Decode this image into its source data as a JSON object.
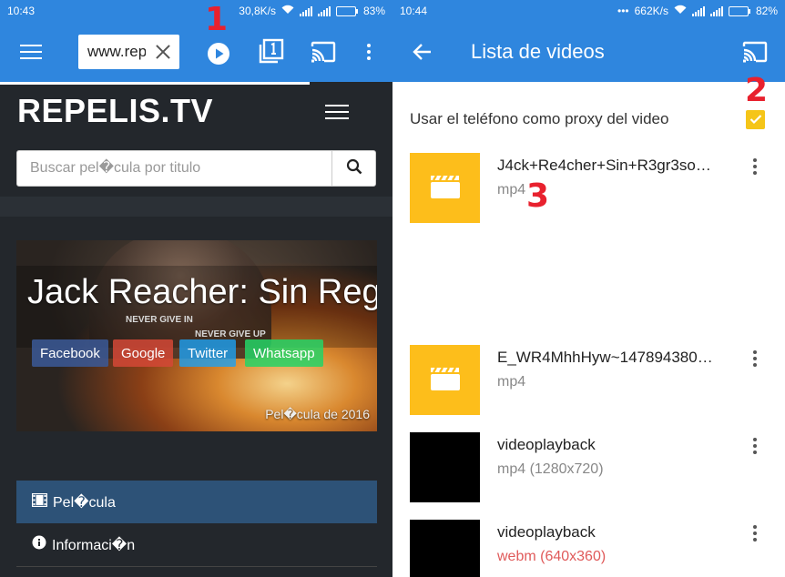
{
  "left": {
    "status": {
      "time": "10:43",
      "speed": "30,8K/s",
      "battery": "83%",
      "battery_level": 0.83
    },
    "toolbar": {
      "url": "www.repelis.tv"
    },
    "page_progress": 0.79,
    "site": {
      "title": "REPELIS.TV",
      "search_placeholder": "Buscar pel�cula por titulo",
      "poster": {
        "title": "Jack Reacher: Sin Reg…",
        "tagline_1": "NEVER GIVE IN",
        "tagline_2": "NEVER GIVE UP",
        "share": [
          "Facebook",
          "Google",
          "Twitter",
          "Whatsapp"
        ],
        "footer": "Pel�cula de 2016"
      },
      "nav": [
        {
          "icon": "film-icon",
          "label": "Pel�cula"
        },
        {
          "icon": "info-icon",
          "label": "Informaci�n"
        }
      ]
    }
  },
  "right": {
    "status": {
      "time": "10:44",
      "speed": "662K/s",
      "battery": "82%",
      "battery_level": 0.82
    },
    "toolbar": {
      "title": "Lista de videos"
    },
    "proxy": {
      "label": "Usar el teléfono como proxy del video",
      "checked": true
    },
    "videos": [
      {
        "name": "J4ck+Re4cher+Sin+R3gr3so…",
        "meta": "mp4",
        "thumb": "yellow"
      },
      {
        "name": "E_WR4MhhHyw~147894380…",
        "meta": "mp4",
        "thumb": "yellow"
      },
      {
        "name": "videoplayback",
        "meta": "mp4 (1280x720)",
        "thumb": "black"
      },
      {
        "name": "videoplayback",
        "meta": "webm (640x360)",
        "thumb": "black",
        "meta_color": "#e05a5a"
      }
    ]
  },
  "annotations": [
    "1",
    "2",
    "3"
  ],
  "colors": {
    "primary": "#2f86de",
    "accent": "#f5c518",
    "thumb_yellow": "#fdbe1b",
    "nav_active": "#2d5277",
    "dark_bg": "#23272c"
  }
}
